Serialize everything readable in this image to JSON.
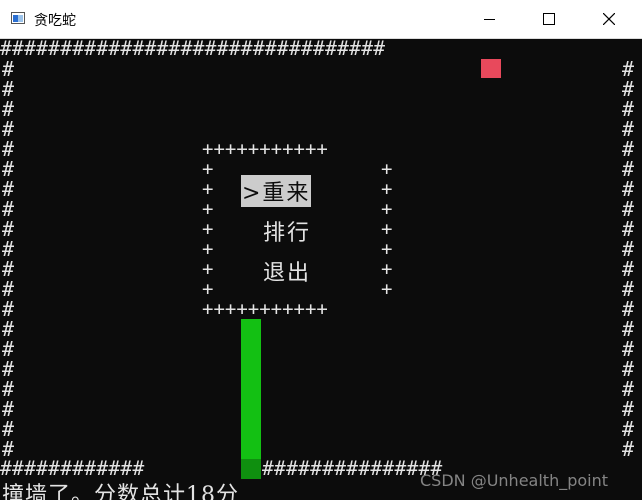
{
  "window": {
    "title": "贪吃蛇"
  },
  "board": {
    "border_char": "#",
    "top_row": "################################",
    "bottom_row_left": "############",
    "bottom_row_right": "###############",
    "left_wall": "#",
    "right_wall": "#",
    "wall_rows": 20
  },
  "menu": {
    "frame_top": "+++++++++++",
    "frame_bottom": "+++++++++++",
    "frame_side": "+",
    "items": [
      {
        "label": ">重来",
        "selected": true
      },
      {
        "label": "排行",
        "selected": false
      },
      {
        "label": "退出",
        "selected": false
      }
    ]
  },
  "status": {
    "message": "撞墙了。分数总计18分"
  },
  "watermark": {
    "text": "CSDN @Unhealth_point"
  },
  "colors": {
    "food": "#e8495c",
    "snake": "#13c013",
    "background": "#0c0c0c",
    "text": "#e4e4e4"
  }
}
